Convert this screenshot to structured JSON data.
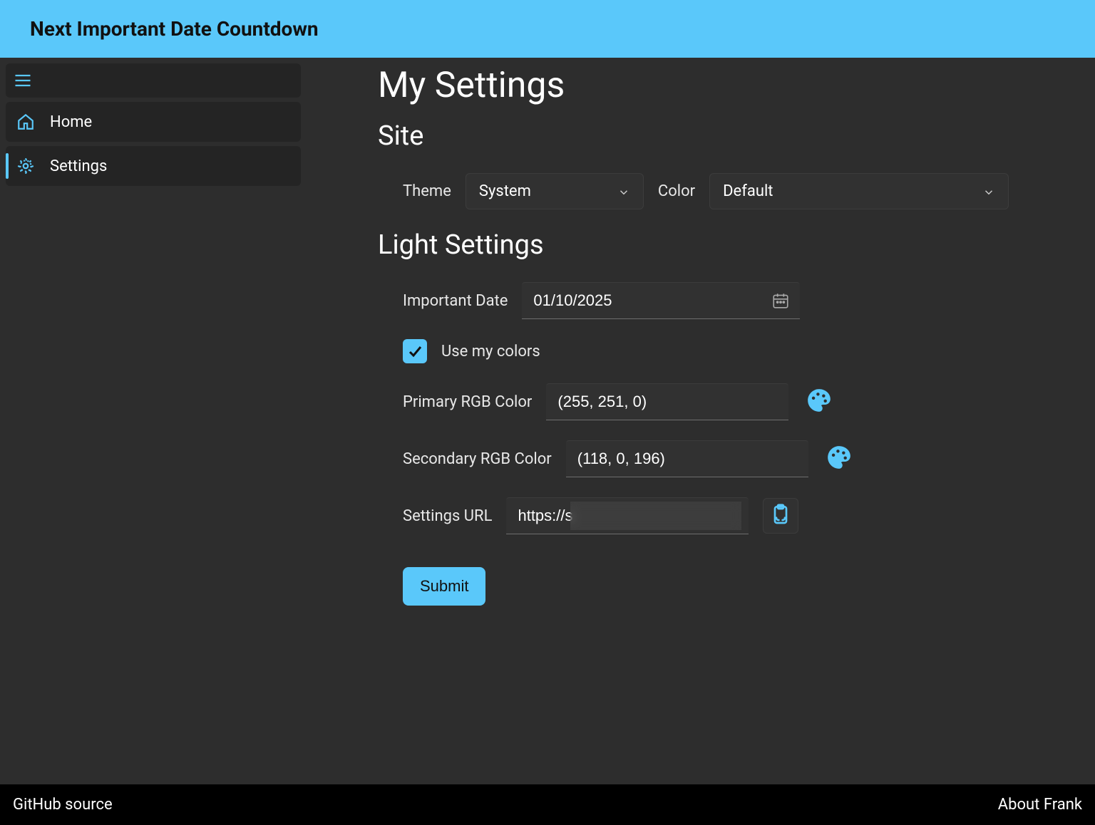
{
  "header": {
    "title": "Next Important Date Countdown"
  },
  "sidebar": {
    "items": [
      {
        "label": "Home"
      },
      {
        "label": "Settings"
      }
    ]
  },
  "page": {
    "title": "My Settings",
    "site_section": "Site",
    "light_section": "Light Settings"
  },
  "site": {
    "theme_label": "Theme",
    "theme_value": "System",
    "color_label": "Color",
    "color_value": "Default"
  },
  "light": {
    "date_label": "Important Date",
    "date_value": "01/10/2025",
    "use_colors_label": "Use my colors",
    "use_colors_checked": true,
    "primary_label": "Primary RGB Color",
    "primary_value": "(255, 251, 0)",
    "secondary_label": "Secondary RGB Color",
    "secondary_value": "(118, 0, 196)",
    "url_label": "Settings URL",
    "url_value": "https://s",
    "submit_label": "Submit"
  },
  "footer": {
    "left": "GitHub source",
    "right": "About Frank"
  },
  "colors": {
    "accent": "#5ac8fa"
  }
}
